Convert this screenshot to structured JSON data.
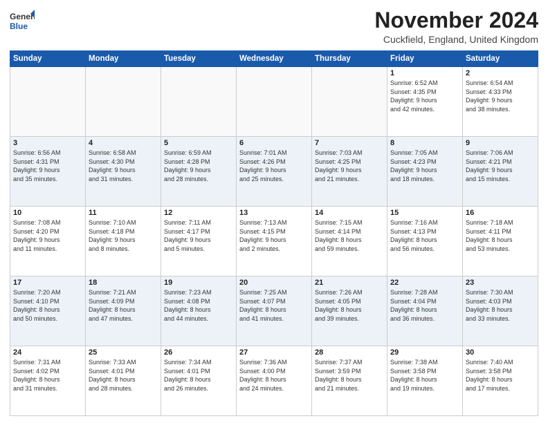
{
  "header": {
    "logo_line1": "General",
    "logo_line2": "Blue",
    "month": "November 2024",
    "location": "Cuckfield, England, United Kingdom"
  },
  "weekdays": [
    "Sunday",
    "Monday",
    "Tuesday",
    "Wednesday",
    "Thursday",
    "Friday",
    "Saturday"
  ],
  "weeks": [
    [
      {
        "day": "",
        "info": ""
      },
      {
        "day": "",
        "info": ""
      },
      {
        "day": "",
        "info": ""
      },
      {
        "day": "",
        "info": ""
      },
      {
        "day": "",
        "info": ""
      },
      {
        "day": "1",
        "info": "Sunrise: 6:52 AM\nSunset: 4:35 PM\nDaylight: 9 hours\nand 42 minutes."
      },
      {
        "day": "2",
        "info": "Sunrise: 6:54 AM\nSunset: 4:33 PM\nDaylight: 9 hours\nand 38 minutes."
      }
    ],
    [
      {
        "day": "3",
        "info": "Sunrise: 6:56 AM\nSunset: 4:31 PM\nDaylight: 9 hours\nand 35 minutes."
      },
      {
        "day": "4",
        "info": "Sunrise: 6:58 AM\nSunset: 4:30 PM\nDaylight: 9 hours\nand 31 minutes."
      },
      {
        "day": "5",
        "info": "Sunrise: 6:59 AM\nSunset: 4:28 PM\nDaylight: 9 hours\nand 28 minutes."
      },
      {
        "day": "6",
        "info": "Sunrise: 7:01 AM\nSunset: 4:26 PM\nDaylight: 9 hours\nand 25 minutes."
      },
      {
        "day": "7",
        "info": "Sunrise: 7:03 AM\nSunset: 4:25 PM\nDaylight: 9 hours\nand 21 minutes."
      },
      {
        "day": "8",
        "info": "Sunrise: 7:05 AM\nSunset: 4:23 PM\nDaylight: 9 hours\nand 18 minutes."
      },
      {
        "day": "9",
        "info": "Sunrise: 7:06 AM\nSunset: 4:21 PM\nDaylight: 9 hours\nand 15 minutes."
      }
    ],
    [
      {
        "day": "10",
        "info": "Sunrise: 7:08 AM\nSunset: 4:20 PM\nDaylight: 9 hours\nand 11 minutes."
      },
      {
        "day": "11",
        "info": "Sunrise: 7:10 AM\nSunset: 4:18 PM\nDaylight: 9 hours\nand 8 minutes."
      },
      {
        "day": "12",
        "info": "Sunrise: 7:11 AM\nSunset: 4:17 PM\nDaylight: 9 hours\nand 5 minutes."
      },
      {
        "day": "13",
        "info": "Sunrise: 7:13 AM\nSunset: 4:15 PM\nDaylight: 9 hours\nand 2 minutes."
      },
      {
        "day": "14",
        "info": "Sunrise: 7:15 AM\nSunset: 4:14 PM\nDaylight: 8 hours\nand 59 minutes."
      },
      {
        "day": "15",
        "info": "Sunrise: 7:16 AM\nSunset: 4:13 PM\nDaylight: 8 hours\nand 56 minutes."
      },
      {
        "day": "16",
        "info": "Sunrise: 7:18 AM\nSunset: 4:11 PM\nDaylight: 8 hours\nand 53 minutes."
      }
    ],
    [
      {
        "day": "17",
        "info": "Sunrise: 7:20 AM\nSunset: 4:10 PM\nDaylight: 8 hours\nand 50 minutes."
      },
      {
        "day": "18",
        "info": "Sunrise: 7:21 AM\nSunset: 4:09 PM\nDaylight: 8 hours\nand 47 minutes."
      },
      {
        "day": "19",
        "info": "Sunrise: 7:23 AM\nSunset: 4:08 PM\nDaylight: 8 hours\nand 44 minutes."
      },
      {
        "day": "20",
        "info": "Sunrise: 7:25 AM\nSunset: 4:07 PM\nDaylight: 8 hours\nand 41 minutes."
      },
      {
        "day": "21",
        "info": "Sunrise: 7:26 AM\nSunset: 4:05 PM\nDaylight: 8 hours\nand 39 minutes."
      },
      {
        "day": "22",
        "info": "Sunrise: 7:28 AM\nSunset: 4:04 PM\nDaylight: 8 hours\nand 36 minutes."
      },
      {
        "day": "23",
        "info": "Sunrise: 7:30 AM\nSunset: 4:03 PM\nDaylight: 8 hours\nand 33 minutes."
      }
    ],
    [
      {
        "day": "24",
        "info": "Sunrise: 7:31 AM\nSunset: 4:02 PM\nDaylight: 8 hours\nand 31 minutes."
      },
      {
        "day": "25",
        "info": "Sunrise: 7:33 AM\nSunset: 4:01 PM\nDaylight: 8 hours\nand 28 minutes."
      },
      {
        "day": "26",
        "info": "Sunrise: 7:34 AM\nSunset: 4:01 PM\nDaylight: 8 hours\nand 26 minutes."
      },
      {
        "day": "27",
        "info": "Sunrise: 7:36 AM\nSunset: 4:00 PM\nDaylight: 8 hours\nand 24 minutes."
      },
      {
        "day": "28",
        "info": "Sunrise: 7:37 AM\nSunset: 3:59 PM\nDaylight: 8 hours\nand 21 minutes."
      },
      {
        "day": "29",
        "info": "Sunrise: 7:38 AM\nSunset: 3:58 PM\nDaylight: 8 hours\nand 19 minutes."
      },
      {
        "day": "30",
        "info": "Sunrise: 7:40 AM\nSunset: 3:58 PM\nDaylight: 8 hours\nand 17 minutes."
      }
    ]
  ]
}
